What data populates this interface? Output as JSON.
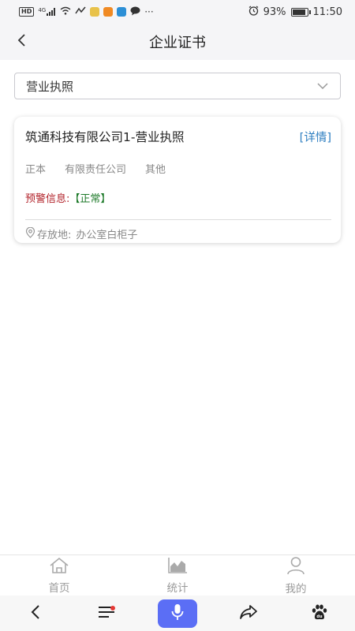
{
  "status_bar": {
    "network_badge": "HD",
    "signal_label": "4G",
    "battery_percent": "93%",
    "battery_level": 0.93,
    "time": "11:50",
    "more": "···"
  },
  "header": {
    "title": "企业证书"
  },
  "filter": {
    "selected": "营业执照"
  },
  "certificates": [
    {
      "title": "筑通科技有限公司1-营业执照",
      "detail_label": "[详情]",
      "copy_type": "正本",
      "company_type": "有限责任公司",
      "category": "其他",
      "warning_label": "预警信息:",
      "warning_status": "【正常】",
      "location_label": "存放地:",
      "location_value": "办公室白柜子"
    }
  ],
  "tabbar": {
    "items": [
      {
        "label": "首页",
        "icon": "home-icon"
      },
      {
        "label": "统计",
        "icon": "chart-icon"
      },
      {
        "label": "我的",
        "icon": "user-icon"
      }
    ]
  },
  "navbar": {
    "items": [
      "back-icon",
      "menu-icon",
      "microphone-icon",
      "share-icon",
      "baidu-paw-icon"
    ]
  },
  "colors": {
    "accent": "#2f7fc1",
    "warning_red": "#b2222a",
    "normal_green": "#1e7a2a",
    "mic_button": "#5b6ef5"
  }
}
